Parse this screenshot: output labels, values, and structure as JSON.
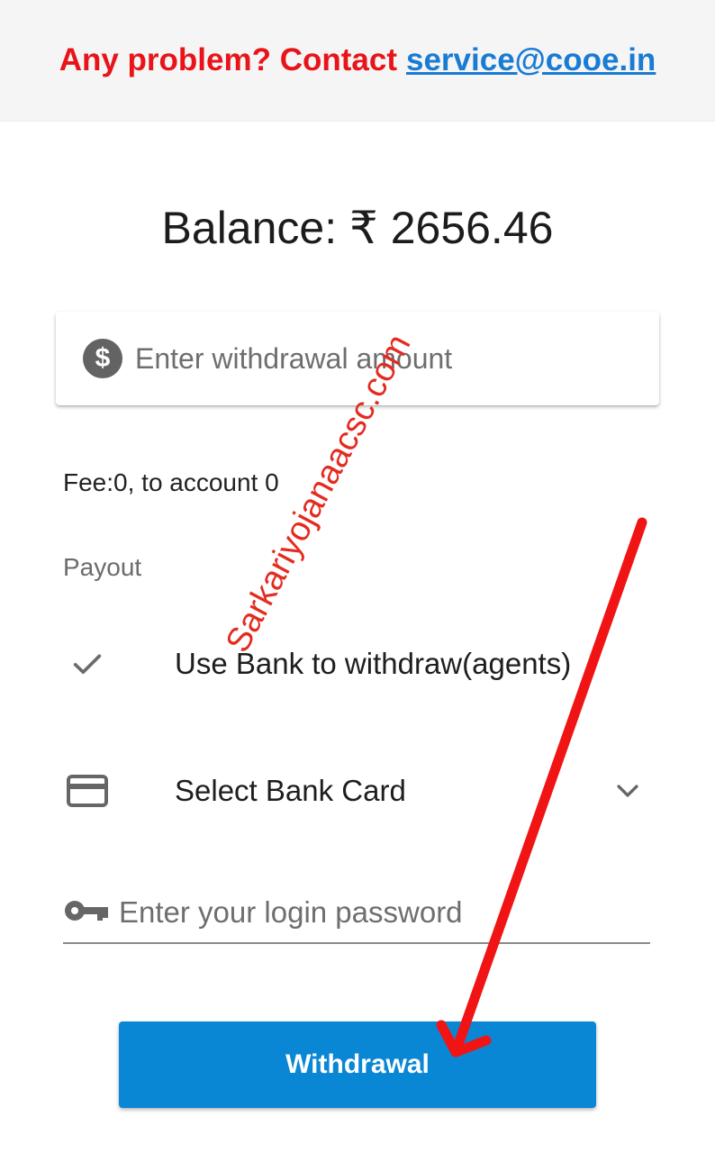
{
  "banner": {
    "prefix": "Any problem? Contact",
    "email": "service@cooe.in"
  },
  "balance": {
    "text": "Balance: ₹ 2656.46"
  },
  "amount": {
    "icon": "dollar-circle-icon",
    "placeholder": "Enter withdrawal amount",
    "value": ""
  },
  "fee_text": "Fee:0, to account 0",
  "payout": {
    "label": "Payout",
    "method": {
      "icon": "check-icon",
      "label": "Use Bank to withdraw(agents)"
    },
    "bank_card": {
      "icon": "credit-card-icon",
      "label": "Select Bank Card",
      "dropdown_icon": "chevron-down-icon"
    }
  },
  "password": {
    "icon": "key-icon",
    "placeholder": "Enter your login password",
    "value": ""
  },
  "submit": {
    "label": "Withdrawal",
    "color": "#0a87d4"
  },
  "overlay": {
    "watermark": "Sarkariyojanaacsc.com",
    "arrow_color": "#f01414"
  }
}
